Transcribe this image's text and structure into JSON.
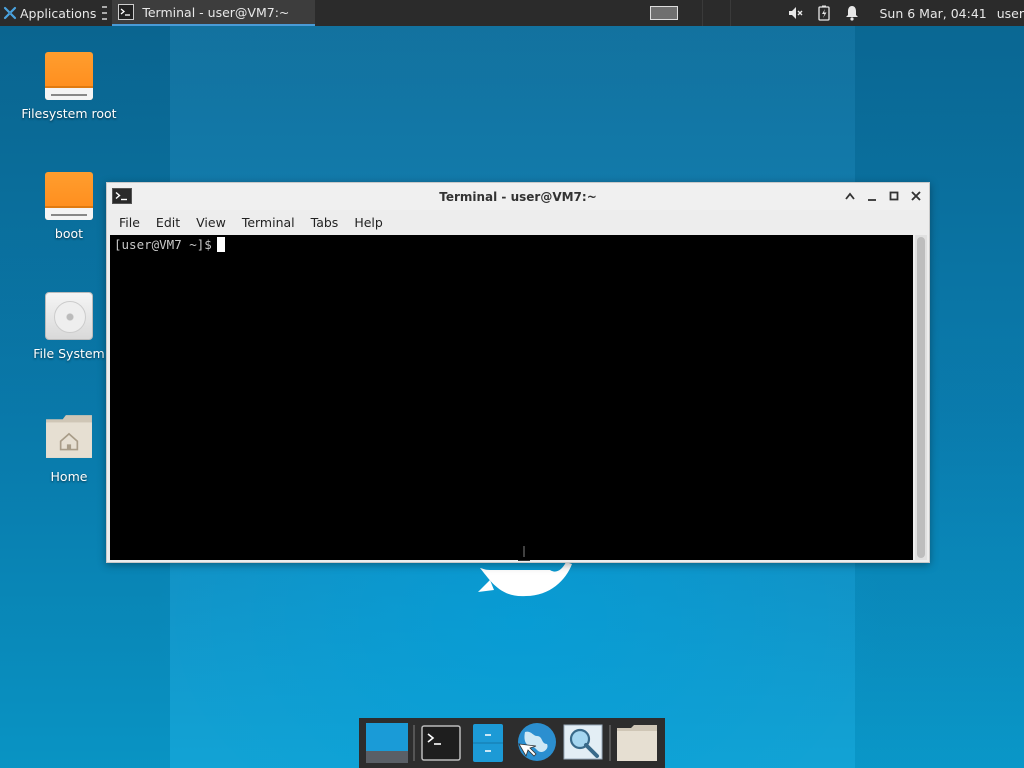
{
  "top_panel": {
    "applications_label": "Applications",
    "task_title": "Terminal - user@VM7:~",
    "clock": "Sun  6 Mar, 04:41",
    "user": "user"
  },
  "desktop_icons": [
    {
      "label": "Filesystem root",
      "icon": "drive-icon"
    },
    {
      "label": "boot",
      "icon": "drive-icon"
    },
    {
      "label": "File System",
      "icon": "harddisk-icon"
    },
    {
      "label": "Home",
      "icon": "home-folder-icon"
    }
  ],
  "terminal": {
    "title": "Terminal - user@VM7:~",
    "menu": [
      "File",
      "Edit",
      "View",
      "Terminal",
      "Tabs",
      "Help"
    ],
    "prompt": "[user@VM7 ~]$"
  },
  "dock": {
    "items": [
      "show-desktop",
      "terminal",
      "file-manager",
      "web-browser",
      "app-finder",
      "folder"
    ]
  },
  "colors": {
    "panel_bg": "#2b2b2b",
    "accent": "#4a9bd6",
    "desktop_blue": "#0a83b8",
    "drive_orange": "#ff8a1a"
  }
}
